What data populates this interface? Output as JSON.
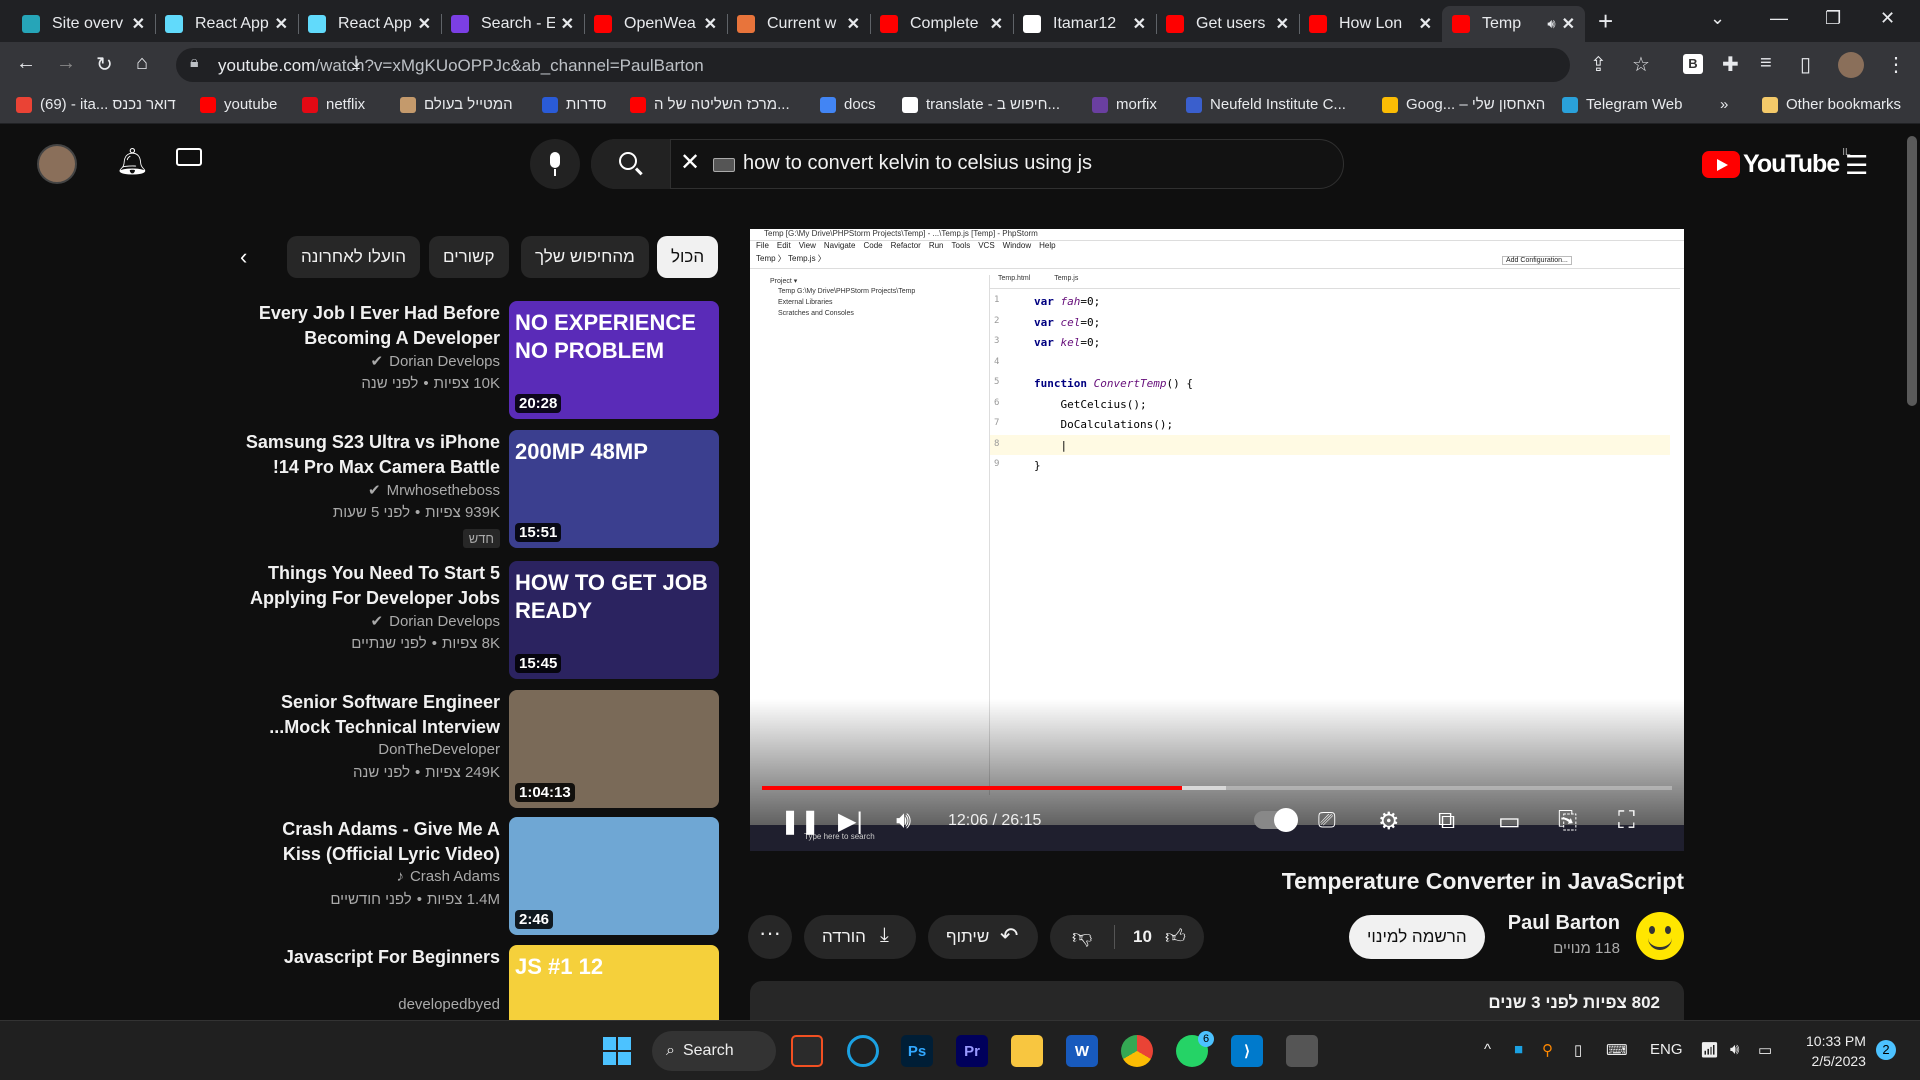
{
  "browser": {
    "tabs": [
      {
        "label": "Site overv",
        "color": "#26a5b8"
      },
      {
        "label": "React App",
        "color": "#61dafb"
      },
      {
        "label": "React App",
        "color": "#61dafb"
      },
      {
        "label": "Search - E",
        "color": "#7b3fe4"
      },
      {
        "label": "OpenWea",
        "color": "#ff0000"
      },
      {
        "label": "Current w",
        "color": "#e8743b"
      },
      {
        "label": "Complete",
        "color": "#ff0000"
      },
      {
        "label": "Itamar12",
        "color": "#ffffff"
      },
      {
        "label": "Get users",
        "color": "#ff0000"
      },
      {
        "label": "How Lon",
        "color": "#ff0000"
      },
      {
        "label": "Temp",
        "color": "#ff0000"
      }
    ],
    "new_tab": "+",
    "url_domain": "youtube.com",
    "url_path": "/watch?v=xMgKUoOPPJc&ab_channel=PaulBarton",
    "bookmarks": [
      {
        "label": "(69) - ita... דואר נכנס",
        "color": "#ea4335"
      },
      {
        "label": "youtube",
        "color": "#ff0000"
      },
      {
        "label": "netflix",
        "color": "#e50914"
      },
      {
        "label": "המטייל בעולם",
        "color": "#c49a6c"
      },
      {
        "label": "סדרות",
        "color": "#2a5bd7"
      },
      {
        "label": "מרכז השליטה של ה...",
        "color": "#ff0000"
      },
      {
        "label": "docs",
        "color": "#4285f4"
      },
      {
        "label": "translate - חיפוש ב...",
        "color": "#ffffff"
      },
      {
        "label": "morfix",
        "color": "#6a3fa0"
      },
      {
        "label": "Neufeld Institute C...",
        "color": "#3a5fcd"
      },
      {
        "label": "Goog... – האחסון שלי",
        "color": "#fbbc04"
      },
      {
        "label": "Telegram Web",
        "color": "#2aa1da"
      },
      {
        "label": "»",
        "color": ""
      },
      {
        "label": "Other bookmarks",
        "color": "#f3c969"
      }
    ]
  },
  "youtube": {
    "search_query": "how to convert kelvin to celsius using js",
    "logo_text": "YouTube",
    "logo_region": "IL",
    "chips": [
      "הכול",
      "מהחיפוש שלך",
      "קשורים",
      "הועלו לאחרונה"
    ],
    "recommendations": [
      {
        "title": "Every Job I Ever Had Before Becoming A Developer",
        "channel": "Dorian Develops",
        "verified": true,
        "views": "10K צפיות",
        "age": "לפני שנה",
        "duration": "20:28",
        "thumb_text": "NO EXPERIENCE NO PROBLEM",
        "thumb_color": "#5a2bb8"
      },
      {
        "title": "Samsung S23 Ultra vs iPhone 14 Pro Max Camera Battle!",
        "channel": "Mrwhosetheboss",
        "verified": true,
        "views": "939K צפיות",
        "age": "לפני 5 שעות",
        "duration": "15:51",
        "badge": "חדש",
        "thumb_text": "200MP 48MP",
        "thumb_color": "#3b3f8f"
      },
      {
        "title": "Things You Need To Start 5 Applying For Developer Jobs",
        "channel": "Dorian Develops",
        "verified": true,
        "views": "8K צפיות",
        "age": "לפני שנתיים",
        "duration": "15:45",
        "thumb_text": "HOW TO GET JOB READY",
        "thumb_color": "#2b2360"
      },
      {
        "title": "Senior Software Engineer Mock Technical Interview...",
        "channel": "DonTheDeveloper",
        "verified": false,
        "views": "249K צפיות",
        "age": "לפני שנה",
        "duration": "1:04:13",
        "thumb_text": "",
        "thumb_color": "#7a6a58"
      },
      {
        "title": "Crash Adams - Give Me A Kiss (Official Lyric Video)",
        "channel": "Crash Adams",
        "verified": false,
        "music": true,
        "views": "1.4M צפיות",
        "age": "לפני חודשיים",
        "duration": "2:46",
        "thumb_text": "",
        "thumb_color": "#6fa7d4"
      },
      {
        "title": "Javascript For Beginners",
        "channel": "developedbyed",
        "verified": false,
        "views": "",
        "age": "",
        "duration": "",
        "thumb_text": "JS #1 12",
        "thumb_color": "#f5d03b"
      }
    ],
    "player": {
      "ide_title": "Temp [G:\\My Drive\\PHPStorm Projects\\Temp] - ...\\Temp.js [Temp] - PhpStorm",
      "ide_menu": [
        "File",
        "Edit",
        "View",
        "Navigate",
        "Code",
        "Refactor",
        "Run",
        "Tools",
        "VCS",
        "Window",
        "Help"
      ],
      "ide_crumbs": "Temp 〉 Temp.js 〉",
      "ide_tabs": [
        "Temp.html",
        "Temp.js"
      ],
      "ide_config": "Add Configuration...",
      "project_tree": [
        "Project ▾",
        "Temp  G:\\My Drive\\PHPStorm Projects\\Temp",
        "External Libraries",
        "Scratches and Consoles"
      ],
      "code_lines": [
        {
          "n": "1",
          "text": "var fah=0;"
        },
        {
          "n": "2",
          "text": "var cel=0;"
        },
        {
          "n": "3",
          "text": "var kel=0;"
        },
        {
          "n": "4",
          "text": ""
        },
        {
          "n": "5",
          "text": "function ConvertTemp() {"
        },
        {
          "n": "6",
          "text": "    GetCelcius();"
        },
        {
          "n": "7",
          "text": "    DoCalculations();"
        },
        {
          "n": "8",
          "text": "    |"
        },
        {
          "n": "9",
          "text": "}"
        }
      ],
      "time_current": "12:06",
      "time_total": "26:15",
      "progress_fraction": 0.461,
      "buffered_fraction": 0.51,
      "taskbar_search": "Type here to search"
    },
    "video_title": "Temperature Converter in JavaScript",
    "channel_name": "Paul Barton",
    "subscribers": "118 מנויים",
    "subscribe_label": "הרשמה למינוי",
    "like_count": "10",
    "share_label": "שיתוף",
    "download_label": "הורדה",
    "views_line": "802 צפיות  לפני 3 שנים"
  },
  "taskbar": {
    "search_label": "Search",
    "whatsapp_badge": "6",
    "lang": "ENG",
    "time": "10:33 PM",
    "date": "2/5/2023",
    "notifications": "2"
  }
}
